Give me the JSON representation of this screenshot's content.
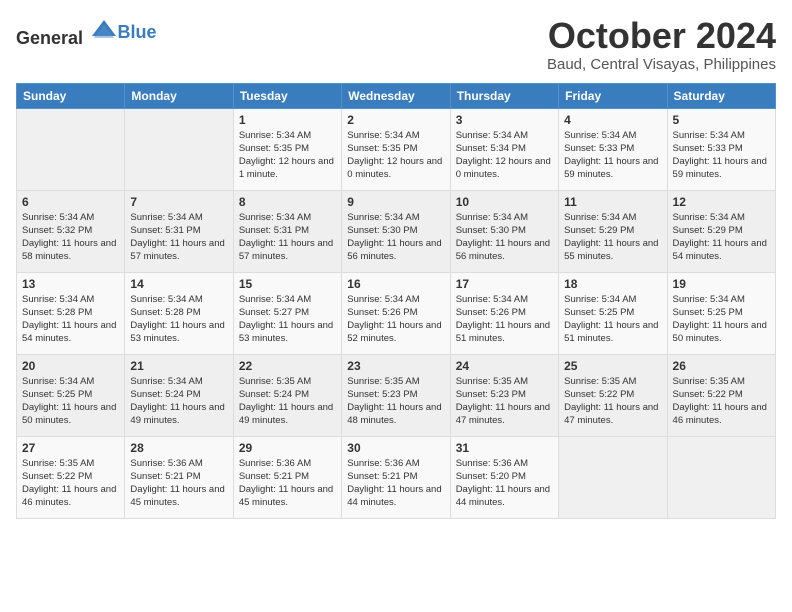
{
  "header": {
    "logo_general": "General",
    "logo_blue": "Blue",
    "month": "October 2024",
    "location": "Baud, Central Visayas, Philippines"
  },
  "weekdays": [
    "Sunday",
    "Monday",
    "Tuesday",
    "Wednesday",
    "Thursday",
    "Friday",
    "Saturday"
  ],
  "weeks": [
    [
      {
        "day": "",
        "sunrise": "",
        "sunset": "",
        "daylight": ""
      },
      {
        "day": "",
        "sunrise": "",
        "sunset": "",
        "daylight": ""
      },
      {
        "day": "1",
        "sunrise": "Sunrise: 5:34 AM",
        "sunset": "Sunset: 5:35 PM",
        "daylight": "Daylight: 12 hours and 1 minute."
      },
      {
        "day": "2",
        "sunrise": "Sunrise: 5:34 AM",
        "sunset": "Sunset: 5:35 PM",
        "daylight": "Daylight: 12 hours and 0 minutes."
      },
      {
        "day": "3",
        "sunrise": "Sunrise: 5:34 AM",
        "sunset": "Sunset: 5:34 PM",
        "daylight": "Daylight: 12 hours and 0 minutes."
      },
      {
        "day": "4",
        "sunrise": "Sunrise: 5:34 AM",
        "sunset": "Sunset: 5:33 PM",
        "daylight": "Daylight: 11 hours and 59 minutes."
      },
      {
        "day": "5",
        "sunrise": "Sunrise: 5:34 AM",
        "sunset": "Sunset: 5:33 PM",
        "daylight": "Daylight: 11 hours and 59 minutes."
      }
    ],
    [
      {
        "day": "6",
        "sunrise": "Sunrise: 5:34 AM",
        "sunset": "Sunset: 5:32 PM",
        "daylight": "Daylight: 11 hours and 58 minutes."
      },
      {
        "day": "7",
        "sunrise": "Sunrise: 5:34 AM",
        "sunset": "Sunset: 5:31 PM",
        "daylight": "Daylight: 11 hours and 57 minutes."
      },
      {
        "day": "8",
        "sunrise": "Sunrise: 5:34 AM",
        "sunset": "Sunset: 5:31 PM",
        "daylight": "Daylight: 11 hours and 57 minutes."
      },
      {
        "day": "9",
        "sunrise": "Sunrise: 5:34 AM",
        "sunset": "Sunset: 5:30 PM",
        "daylight": "Daylight: 11 hours and 56 minutes."
      },
      {
        "day": "10",
        "sunrise": "Sunrise: 5:34 AM",
        "sunset": "Sunset: 5:30 PM",
        "daylight": "Daylight: 11 hours and 56 minutes."
      },
      {
        "day": "11",
        "sunrise": "Sunrise: 5:34 AM",
        "sunset": "Sunset: 5:29 PM",
        "daylight": "Daylight: 11 hours and 55 minutes."
      },
      {
        "day": "12",
        "sunrise": "Sunrise: 5:34 AM",
        "sunset": "Sunset: 5:29 PM",
        "daylight": "Daylight: 11 hours and 54 minutes."
      }
    ],
    [
      {
        "day": "13",
        "sunrise": "Sunrise: 5:34 AM",
        "sunset": "Sunset: 5:28 PM",
        "daylight": "Daylight: 11 hours and 54 minutes."
      },
      {
        "day": "14",
        "sunrise": "Sunrise: 5:34 AM",
        "sunset": "Sunset: 5:28 PM",
        "daylight": "Daylight: 11 hours and 53 minutes."
      },
      {
        "day": "15",
        "sunrise": "Sunrise: 5:34 AM",
        "sunset": "Sunset: 5:27 PM",
        "daylight": "Daylight: 11 hours and 53 minutes."
      },
      {
        "day": "16",
        "sunrise": "Sunrise: 5:34 AM",
        "sunset": "Sunset: 5:26 PM",
        "daylight": "Daylight: 11 hours and 52 minutes."
      },
      {
        "day": "17",
        "sunrise": "Sunrise: 5:34 AM",
        "sunset": "Sunset: 5:26 PM",
        "daylight": "Daylight: 11 hours and 51 minutes."
      },
      {
        "day": "18",
        "sunrise": "Sunrise: 5:34 AM",
        "sunset": "Sunset: 5:25 PM",
        "daylight": "Daylight: 11 hours and 51 minutes."
      },
      {
        "day": "19",
        "sunrise": "Sunrise: 5:34 AM",
        "sunset": "Sunset: 5:25 PM",
        "daylight": "Daylight: 11 hours and 50 minutes."
      }
    ],
    [
      {
        "day": "20",
        "sunrise": "Sunrise: 5:34 AM",
        "sunset": "Sunset: 5:25 PM",
        "daylight": "Daylight: 11 hours and 50 minutes."
      },
      {
        "day": "21",
        "sunrise": "Sunrise: 5:34 AM",
        "sunset": "Sunset: 5:24 PM",
        "daylight": "Daylight: 11 hours and 49 minutes."
      },
      {
        "day": "22",
        "sunrise": "Sunrise: 5:35 AM",
        "sunset": "Sunset: 5:24 PM",
        "daylight": "Daylight: 11 hours and 49 minutes."
      },
      {
        "day": "23",
        "sunrise": "Sunrise: 5:35 AM",
        "sunset": "Sunset: 5:23 PM",
        "daylight": "Daylight: 11 hours and 48 minutes."
      },
      {
        "day": "24",
        "sunrise": "Sunrise: 5:35 AM",
        "sunset": "Sunset: 5:23 PM",
        "daylight": "Daylight: 11 hours and 47 minutes."
      },
      {
        "day": "25",
        "sunrise": "Sunrise: 5:35 AM",
        "sunset": "Sunset: 5:22 PM",
        "daylight": "Daylight: 11 hours and 47 minutes."
      },
      {
        "day": "26",
        "sunrise": "Sunrise: 5:35 AM",
        "sunset": "Sunset: 5:22 PM",
        "daylight": "Daylight: 11 hours and 46 minutes."
      }
    ],
    [
      {
        "day": "27",
        "sunrise": "Sunrise: 5:35 AM",
        "sunset": "Sunset: 5:22 PM",
        "daylight": "Daylight: 11 hours and 46 minutes."
      },
      {
        "day": "28",
        "sunrise": "Sunrise: 5:36 AM",
        "sunset": "Sunset: 5:21 PM",
        "daylight": "Daylight: 11 hours and 45 minutes."
      },
      {
        "day": "29",
        "sunrise": "Sunrise: 5:36 AM",
        "sunset": "Sunset: 5:21 PM",
        "daylight": "Daylight: 11 hours and 45 minutes."
      },
      {
        "day": "30",
        "sunrise": "Sunrise: 5:36 AM",
        "sunset": "Sunset: 5:21 PM",
        "daylight": "Daylight: 11 hours and 44 minutes."
      },
      {
        "day": "31",
        "sunrise": "Sunrise: 5:36 AM",
        "sunset": "Sunset: 5:20 PM",
        "daylight": "Daylight: 11 hours and 44 minutes."
      },
      {
        "day": "",
        "sunrise": "",
        "sunset": "",
        "daylight": ""
      },
      {
        "day": "",
        "sunrise": "",
        "sunset": "",
        "daylight": ""
      }
    ]
  ]
}
